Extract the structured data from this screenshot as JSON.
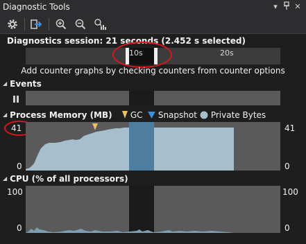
{
  "window": {
    "title": "Diagnostic Tools"
  },
  "toolbar": {
    "buttons": [
      "settings-icon",
      "select-tools-icon",
      "zoom-in-icon",
      "zoom-out-icon",
      "reset-zoom-icon"
    ]
  },
  "session": {
    "label": "Diagnostics session: 21 seconds (2.452 s selected)"
  },
  "ruler": {
    "ticks": [
      "10s",
      "20s"
    ]
  },
  "hint": "Add counter graphs by checking counters from counter options",
  "events": {
    "title": "Events"
  },
  "memory": {
    "title": "Process Memory (MB)",
    "legend": {
      "gc": "GC",
      "snapshot": "Snapshot",
      "private_bytes": "Private Bytes"
    },
    "max_left": "41",
    "min_left": "0",
    "max_right": "41",
    "min_right": "0"
  },
  "cpu": {
    "title": "CPU (% of all processors)",
    "max_left": "100",
    "min_left": "0",
    "max_right": "100",
    "min_right": "0"
  },
  "colors": {
    "background": "#1e1e1e",
    "lane": "#5a5a5a",
    "memory_fill": "#a7bfcc",
    "selection": "#4d7ea0",
    "gc_marker": "#e8c06a",
    "snapshot_marker": "#3a8fd8",
    "annotation": "#e0141e"
  }
}
